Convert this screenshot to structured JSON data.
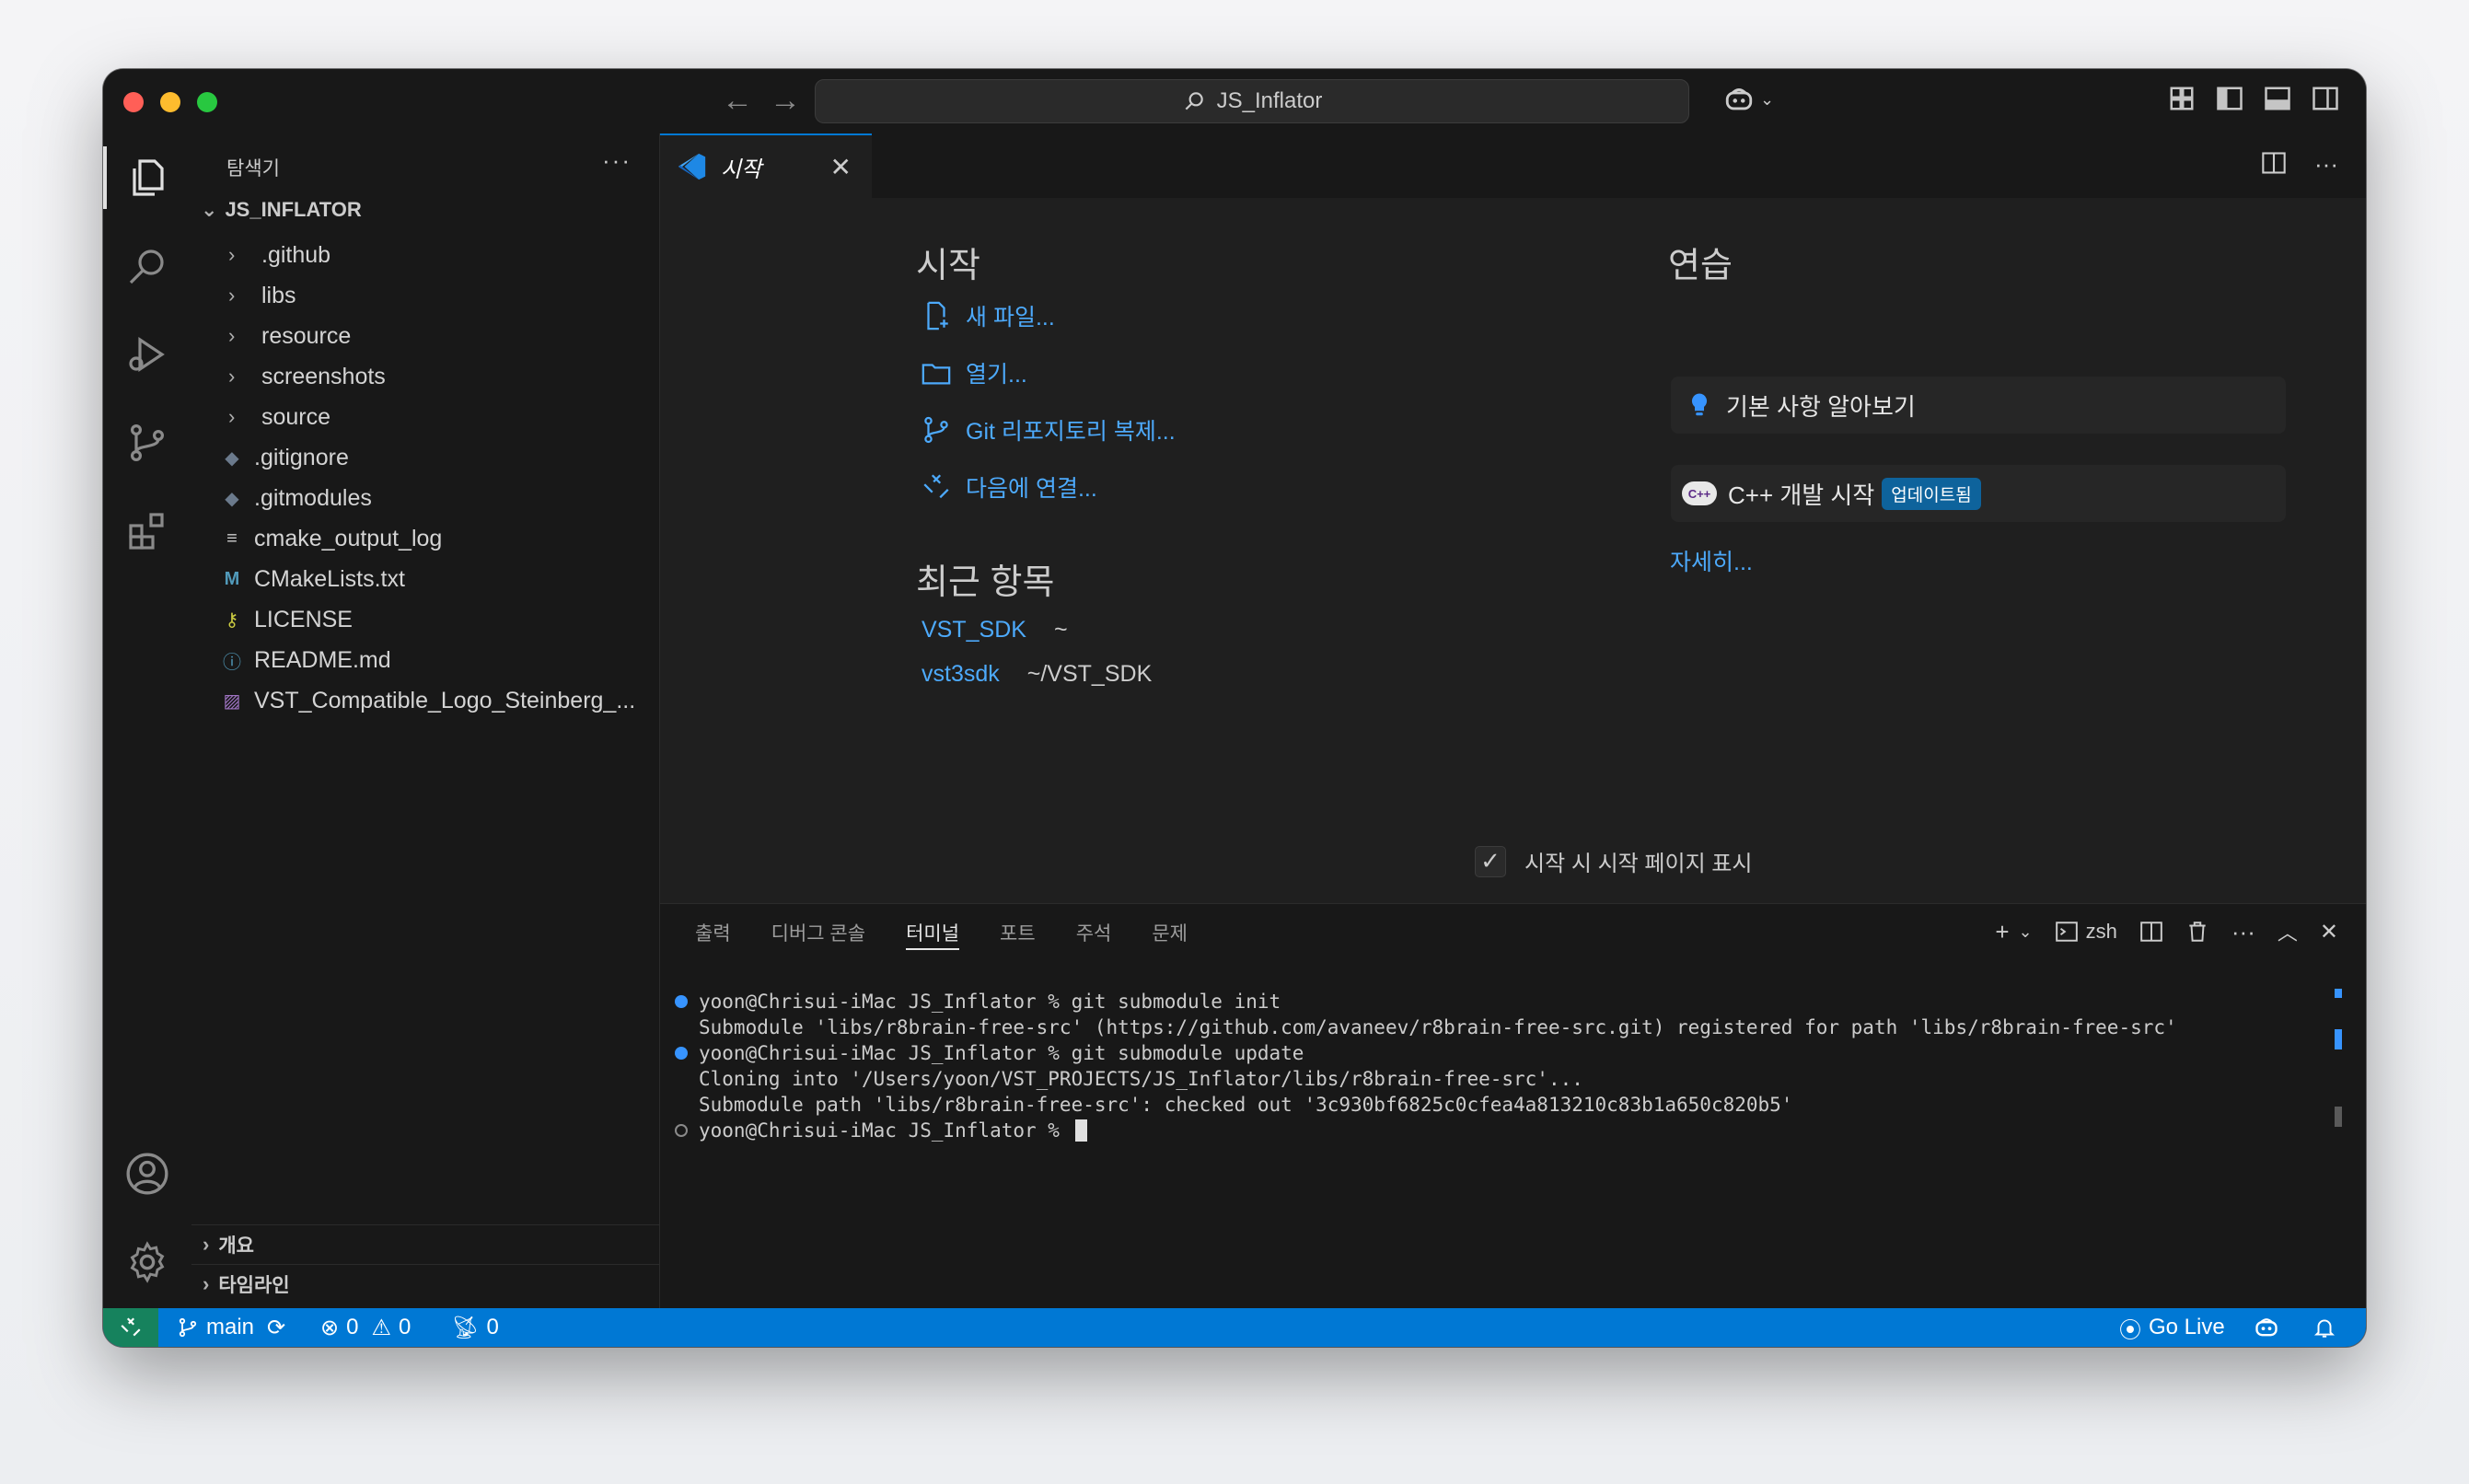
{
  "titlebar": {
    "search_text": "JS_Inflator"
  },
  "sidebar": {
    "title": "탐색기",
    "more": "···",
    "root": "JS_INFLATOR",
    "items": [
      {
        "label": ".github",
        "type": "folder"
      },
      {
        "label": "libs",
        "type": "folder"
      },
      {
        "label": "resource",
        "type": "folder"
      },
      {
        "label": "screenshots",
        "type": "folder"
      },
      {
        "label": "source",
        "type": "folder"
      },
      {
        "label": ".gitignore",
        "type": "git"
      },
      {
        "label": ".gitmodules",
        "type": "git"
      },
      {
        "label": "cmake_output_log",
        "type": "text"
      },
      {
        "label": "CMakeLists.txt",
        "type": "cmake"
      },
      {
        "label": "LICENSE",
        "type": "license"
      },
      {
        "label": "README.md",
        "type": "info"
      },
      {
        "label": "VST_Compatible_Logo_Steinberg_...",
        "type": "image"
      }
    ],
    "sections": [
      "개요",
      "타임라인"
    ]
  },
  "editor": {
    "tab_label": "시작",
    "start_heading": "시작",
    "start_links": [
      "새 파일...",
      "열기...",
      "Git 리포지토리 복제...",
      "다음에 연결..."
    ],
    "recent_heading": "최근 항목",
    "recent": [
      {
        "name": "VST_SDK",
        "path": "~"
      },
      {
        "name": "vst3sdk",
        "path": "~/VST_SDK"
      }
    ],
    "walk_heading": "연습",
    "walkthroughs": [
      {
        "label": "기본 사항 알아보기",
        "badge": ""
      },
      {
        "label": "C++ 개발 시작",
        "badge": "업데이트됨"
      }
    ],
    "more_link": "자세히...",
    "startup_checkbox": "시작 시 시작 페이지 표시"
  },
  "panel": {
    "tabs": [
      "출력",
      "디버그 콘솔",
      "터미널",
      "포트",
      "주석",
      "문제"
    ],
    "active_tab": "터미널",
    "shell": "zsh",
    "terminal_lines": [
      {
        "dot": "blue",
        "text": "yoon@Chrisui-iMac JS_Inflator % git submodule init"
      },
      {
        "dot": "none",
        "text": "Submodule 'libs/r8brain-free-src' (https://github.com/avaneev/r8brain-free-src.git) registered for path 'libs/r8brain-free-src'"
      },
      {
        "dot": "blue",
        "text": "yoon@Chrisui-iMac JS_Inflator % git submodule update"
      },
      {
        "dot": "none",
        "text": "Cloning into '/Users/yoon/VST_PROJECTS/JS_Inflator/libs/r8brain-free-src'..."
      },
      {
        "dot": "none",
        "text": "Submodule path 'libs/r8brain-free-src': checked out '3c930bf6825c0cfea4a813210c83b1a650c820b5'"
      },
      {
        "dot": "hollow",
        "text": "yoon@Chrisui-iMac JS_Inflator % "
      }
    ]
  },
  "statusbar": {
    "branch": "main",
    "errors": "0",
    "warnings": "0",
    "ports": "0",
    "go_live": "Go Live"
  },
  "colors": {
    "accent": "#0078d4",
    "link": "#4daafc",
    "remote": "#16825d",
    "background": "#1f1f1f"
  }
}
